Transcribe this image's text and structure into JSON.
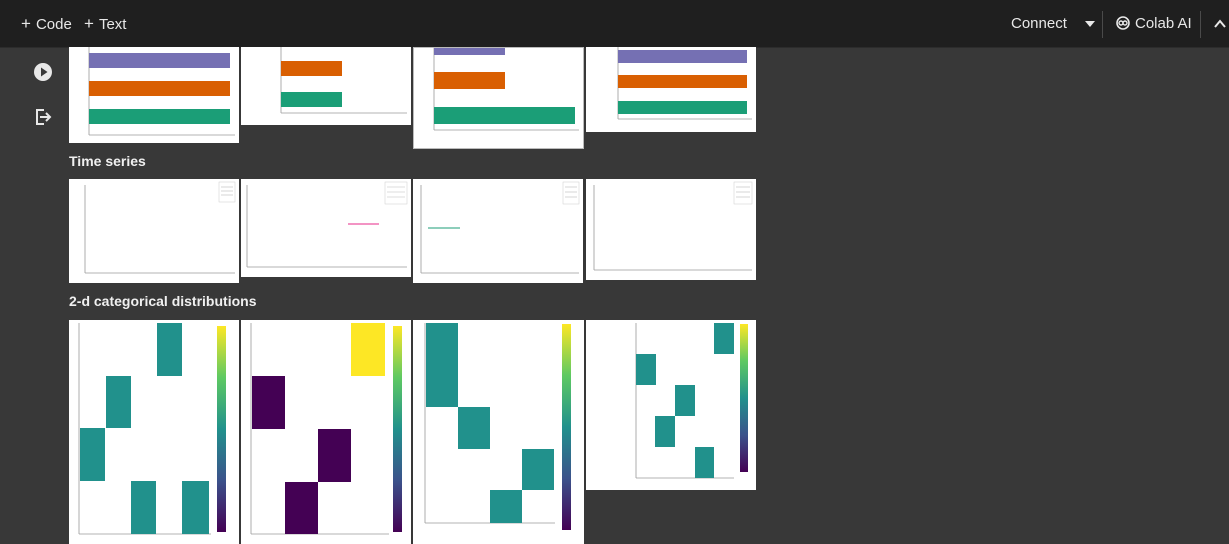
{
  "toolbar": {
    "code_label": "Code",
    "text_label": "Text",
    "connect_label": "Connect",
    "colab_ai_label": "Colab AI"
  },
  "sections": {
    "time_series": "Time series",
    "categorical_2d": "2-d categorical distributions"
  },
  "colors": {
    "purple": "#7570b3",
    "orange": "#d95f02",
    "green": "#1b9e77",
    "teal": "#21918c",
    "yellow": "#fde725",
    "dark_purple": "#440154",
    "magenta": "#e7298a"
  },
  "icons": [
    "run-cell-icon",
    "output-toggle-icon",
    "colab-ai-icon",
    "chevron-up-icon"
  ]
}
